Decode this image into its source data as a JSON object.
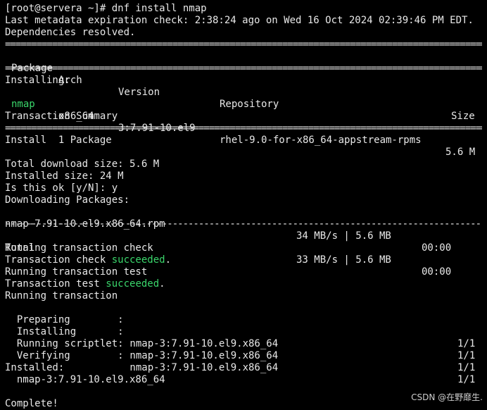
{
  "prompt_line": "[root@servera ~]# dnf install nmap",
  "metadata_line": "Last metadata expiration check: 2:38:24 ago on Wed 16 Oct 2024 02:39:46 PM EDT.",
  "deps_line": "Dependencies resolved.",
  "rule_double": "================================================================================================",
  "rule_single": "------------------------------------------------------------------------------------------------",
  "table_header": {
    "package": "Package",
    "arch": "Arch",
    "version": "Version",
    "repository": "Repository",
    "size": "Size"
  },
  "installing_label": "Installing:",
  "package_row": {
    "name": "nmap",
    "arch": "x86_64",
    "version": "3:7.91-10.el9",
    "repository": "rhel-9.0-for-x86_64-appstream-rpms",
    "size": "5.6 M"
  },
  "transaction_summary": "Transaction Summary",
  "install_count": "Install  1 Package",
  "total_download": "Total download size: 5.6 M",
  "installed_size": "Installed size: 24 M",
  "confirm_prompt": "Is this ok [y/N]: y",
  "downloading": "Downloading Packages:",
  "download_row": {
    "file": "nmap-7.91-10.el9.x86_64.rpm",
    "speed": "34 MB/s | 5.6 MB",
    "time": "00:00"
  },
  "total_row": {
    "label": "Total",
    "speed": "33 MB/s | 5.6 MB",
    "time": "00:00"
  },
  "running_check": "Running transaction check",
  "check_prefix": "Transaction check ",
  "check_status": "succeeded",
  "check_suffix": ".",
  "running_test": "Running transaction test",
  "test_prefix": "Transaction test ",
  "test_status": "succeeded",
  "test_suffix": ".",
  "running_transaction": "Running transaction",
  "steps": [
    {
      "label": "  Preparing        :",
      "pkg": "",
      "count": "1/1"
    },
    {
      "label": "  Installing       :",
      "pkg": " nmap-3:7.91-10.el9.x86_64",
      "count": "1/1"
    },
    {
      "label": "  Running scriptlet:",
      "pkg": " nmap-3:7.91-10.el9.x86_64",
      "count": "1/1"
    },
    {
      "label": "  Verifying        :",
      "pkg": " nmap-3:7.91-10.el9.x86_64",
      "count": "1/1"
    }
  ],
  "installed_label": "Installed:",
  "installed_pkg": "  nmap-3:7.91-10.el9.x86_64",
  "complete": "Complete!",
  "watermark": "CSDN @在野靡生.",
  "colors": {
    "background": "#000000",
    "text": "#e8e8e8",
    "success": "#3ad66b"
  }
}
